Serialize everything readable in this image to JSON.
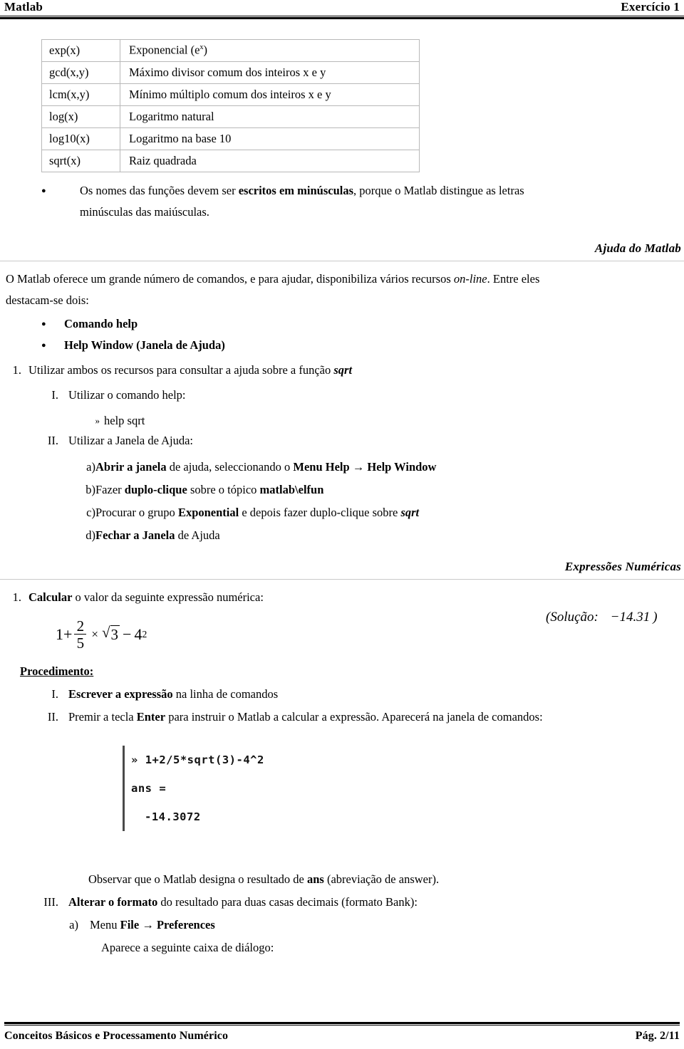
{
  "header": {
    "left_title": "Matlab",
    "right_title": "Exercício 1"
  },
  "function_table": {
    "rows": [
      {
        "name": "exp(x)",
        "desc_pre": "Exponencial (e",
        "desc_sup": "x",
        "desc_post": ")"
      },
      {
        "name": "gcd(x,y)",
        "desc": "Máximo divisor comum dos inteiros x e y"
      },
      {
        "name": "lcm(x,y)",
        "desc": "Mínimo múltiplo comum dos inteiros x e y"
      },
      {
        "name": "log(x)",
        "desc": "Logaritmo natural"
      },
      {
        "name": "log10(x)",
        "desc": "Logaritmo na base 10"
      },
      {
        "name": "sqrt(x)",
        "desc": "Raiz quadrada"
      }
    ]
  },
  "note_bullet": {
    "bullet_glyph": "●",
    "part1": "Os nomes das funções devem ser ",
    "bold1": "escritos em minúsculas",
    "part2": ", porque o Matlab distingue as letras",
    "line2": "minúsculas das maiúsculas."
  },
  "section_help": {
    "heading": "Ajuda do Matlab",
    "intro_part1": "O Matlab oferece um grande número de comandos, e para ajudar, disponibiliza vários recursos ",
    "intro_italic": "on-line",
    "intro_part2": ". Entre eles",
    "intro_line2": "destacam-se dois:",
    "bullets": [
      {
        "glyph": "●",
        "label": "Comando help"
      },
      {
        "glyph": "●",
        "label": "Help Window  (Janela de Ajuda)"
      }
    ],
    "item1_marker": "1.",
    "item1_text": "Utilizar ambos os recursos para consultar a ajuda sobre a função ",
    "item1_bolditalic": "sqrt",
    "sub_I_marker": "I.",
    "sub_I_text": "Utilizar o comando help:",
    "command_prompt": "»",
    "command_text": "help sqrt",
    "sub_II_marker": "II.",
    "sub_II_text": "Utilizar a Janela de Ajuda:",
    "steps": [
      {
        "marker": "a)",
        "bold1": "Abrir a janela",
        "plain1": " de ajuda, seleccionando o ",
        "bold2": "Menu Help",
        "arrow": "→",
        "bold3": "Help Window"
      },
      {
        "marker": "b)",
        "plain0": "Fazer ",
        "bold1": "duplo-clique",
        "plain1": " sobre o tópico ",
        "bold2": "matlab\\elfun"
      },
      {
        "marker": "c)",
        "plain0": "Procurar o grupo ",
        "bold1": "Exponential",
        "plain1": " e depois fazer duplo-clique sobre ",
        "bolditalic": "sqrt"
      },
      {
        "marker": "d)",
        "bold1": "Fechar a Janela",
        "plain1": " de Ajuda"
      }
    ]
  },
  "section_expressions": {
    "heading": "Expressões Numéricas",
    "item1_marker": "1.",
    "item1_bold": "Calcular",
    "item1_text": " o valor da seguinte expressão numérica:",
    "solution_label": "(Solução:",
    "solution_value": "−14.31",
    "solution_close": ")",
    "procedure_label": "Procedimento:",
    "steps": [
      {
        "marker": "I.",
        "bold": "Escrever a expressão",
        "plain": " na linha de comandos"
      },
      {
        "marker": "II.",
        "plain0": "Premir a tecla ",
        "bold": "Enter",
        "plain1": " para instruir o Matlab a calcular a expressão. Aparecerá na janela de comandos:"
      }
    ],
    "observation_pre": "Observar que o Matlab designa o resultado de ",
    "observation_bold": "ans",
    "observation_post": " (abreviação de answer).",
    "step_III": {
      "marker": "III.",
      "bold": "Alterar o formato",
      "plain": " do resultado para duas casas decimais (formato Bank):"
    },
    "step_a": {
      "marker": "a)",
      "plain0": "Menu ",
      "bold1": "File",
      "arrow": "→",
      "bold2": "Preferences"
    },
    "dialog_note": "Aparece a seguinte caixa de diálogo:"
  },
  "math_expression": {
    "lead": "1+",
    "numerator": "2",
    "denominator": "5",
    "times": "×",
    "radical": "√",
    "radicand": "3",
    "minus": "−",
    "base": "4",
    "exponent": "2",
    "plain_text": "1 + (2/5) × √3 − 4²"
  },
  "console": {
    "line1_prompt": "»",
    "line1_command": "1+2/5*sqrt(3)-4^2",
    "line2": "ans =",
    "line3": "-14.3072"
  },
  "footer": {
    "left": "Conceitos Básicos e Processamento Numérico",
    "right": "Pág. 2/11"
  },
  "colors": {
    "text": "#000000",
    "table_rule": "#b8b8b8",
    "section_rule": "#c9c9c9",
    "console_bar": "#4a4a4a"
  }
}
